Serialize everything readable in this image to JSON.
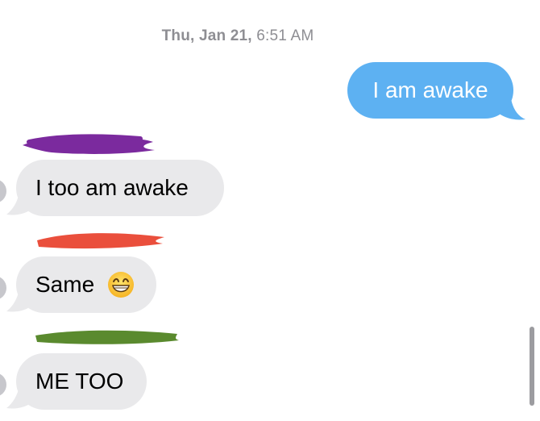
{
  "conversation": {
    "timestamp_day": "Thu, Jan 21,",
    "timestamp_time": "6:51 AM",
    "messages": [
      {
        "direction": "sent",
        "text": "I am awake"
      },
      {
        "direction": "received",
        "sender_redacted": true,
        "redaction_color": "#7b2a9e",
        "text": "I too am awake"
      },
      {
        "direction": "received",
        "sender_redacted": true,
        "redaction_color": "#ea4f3c",
        "text": "Same",
        "emoji": "grinning-face-with-smiling-eyes-icon"
      },
      {
        "direction": "received",
        "sender_redacted": true,
        "redaction_color": "#5a8a2e",
        "text": "ME TOO"
      }
    ]
  },
  "colors": {
    "sent_bubble": "#5db1f2",
    "received_bubble": "#e9e9eb",
    "timestamp_text": "#8e8e93"
  }
}
